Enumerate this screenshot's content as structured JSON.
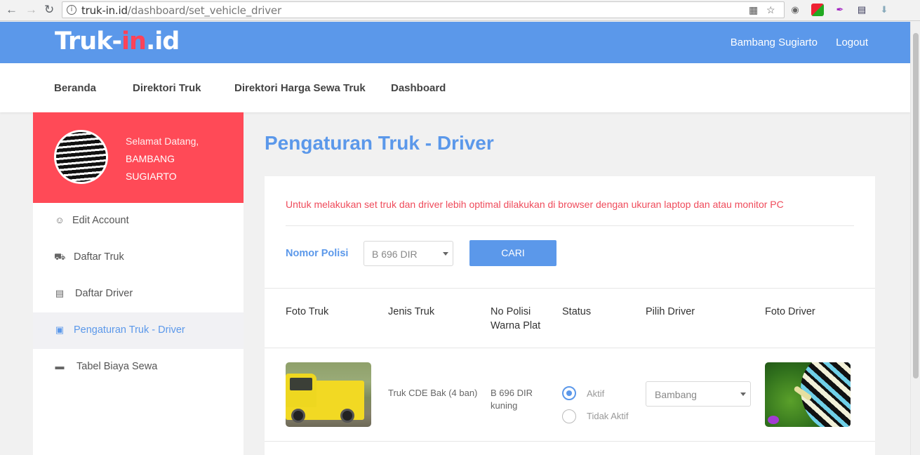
{
  "browser": {
    "url_host": "truk-in.id",
    "url_path": "/dashboard/set_vehicle_driver"
  },
  "header": {
    "logo_part1": "Truk-",
    "logo_part2": "in",
    "logo_part3": ".id",
    "user_name": "Bambang Sugiarto",
    "logout": "Logout"
  },
  "menu": {
    "items": [
      "Beranda",
      "Direktori Truk",
      "Direktori Harga Sewa Truk",
      "Dashboard"
    ]
  },
  "sidebar": {
    "greeting": "Selamat Datang,",
    "name_line1": "BAMBANG",
    "name_line2": "SUGIARTO",
    "items": [
      {
        "label": "Edit Account",
        "icon": "smile-icon"
      },
      {
        "label": "Daftar Truk",
        "icon": "truck-icon"
      },
      {
        "label": "Daftar Driver",
        "icon": "id-card-icon"
      },
      {
        "label": "Pengaturan Truk - Driver",
        "icon": "briefcase-icon",
        "active": true
      },
      {
        "label": "Tabel Biaya Sewa",
        "icon": "credit-card-icon"
      }
    ]
  },
  "main": {
    "title": "Pengaturan Truk - Driver",
    "notice": "Untuk melakukan set truk dan driver lebih optimal dilakukan di browser dengan ukuran laptop dan atau monitor PC",
    "filter_label": "Nomor Polisi",
    "filter_value": "B 696 DIR",
    "search_button": "CARI",
    "columns": {
      "foto_truk": "Foto Truk",
      "jenis_truk": "Jenis Truk",
      "no_polisi_1": "No Polisi",
      "no_polisi_2": "Warna Plat",
      "status": "Status",
      "pilih_driver": "Pilih Driver",
      "foto_driver": "Foto Driver"
    },
    "rows": [
      {
        "jenis_truk": "Truk CDE Bak (4 ban)",
        "no_polisi": "B 696 DIR",
        "warna_plat": "kuning",
        "status_aktif": "Aktif",
        "status_tidak_aktif": "Tidak Aktif",
        "status_selected": "Aktif",
        "driver": "Bambang"
      }
    ]
  },
  "colors": {
    "primary": "#5b98ea",
    "accent_red": "#ff4a57",
    "notice_red": "#ef4b5b"
  }
}
